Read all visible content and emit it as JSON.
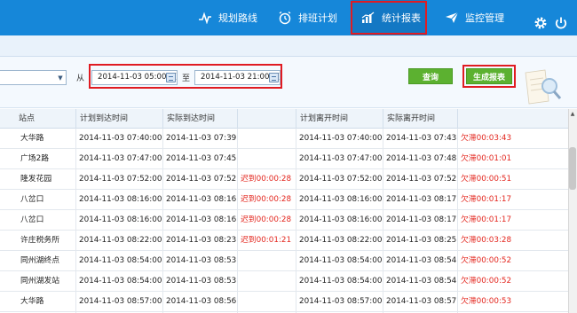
{
  "nav": {
    "items": [
      {
        "label": "规划路线",
        "icon": "route-icon"
      },
      {
        "label": "排班计划",
        "icon": "alarm-clock-icon"
      },
      {
        "label": "统计报表",
        "icon": "bar-chart-icon"
      },
      {
        "label": "监控管理",
        "icon": "send-icon"
      }
    ],
    "active": "统计报表",
    "system_icons": [
      "gear-icon",
      "power-icon"
    ]
  },
  "filter": {
    "combo_value": "",
    "from_label": "从",
    "to_label": "至",
    "start_datetime": "2014-11-03 05:00:0(",
    "end_datetime": "2014-11-03 21:00:0(",
    "query_button": "查询",
    "generate_button": "生成报表"
  },
  "table": {
    "columns": [
      "站点",
      "计划到达时间",
      "实际到达时间",
      "",
      "计划离开时间",
      "实际离开时间",
      ""
    ],
    "rows": [
      {
        "station": "大华路",
        "plan_arrive": "2014-11-03 07:40:00",
        "actual_arrive": "2014-11-03 07:39:53",
        "arrive_status": "",
        "plan_leave": "2014-11-03 07:40:00",
        "actual_leave": "2014-11-03 07:43:43",
        "leave_status": "欠滞00:03:43"
      },
      {
        "station": "广场2路",
        "plan_arrive": "2014-11-03 07:47:00",
        "actual_arrive": "2014-11-03 07:45:30",
        "arrive_status": "",
        "plan_leave": "2014-11-03 07:47:00",
        "actual_leave": "2014-11-03 07:48:01",
        "leave_status": "欠滞00:01:01"
      },
      {
        "station": "隆发花园",
        "plan_arrive": "2014-11-03 07:52:00",
        "actual_arrive": "2014-11-03 07:52:28",
        "arrive_status": "迟到00:00:28",
        "plan_leave": "2014-11-03 07:52:00",
        "actual_leave": "2014-11-03 07:52:51",
        "leave_status": "欠滞00:00:51"
      },
      {
        "station": "八岔口",
        "plan_arrive": "2014-11-03 08:16:00",
        "actual_arrive": "2014-11-03 08:16:28",
        "arrive_status": "迟到00:00:28",
        "plan_leave": "2014-11-03 08:16:00",
        "actual_leave": "2014-11-03 08:17:17",
        "leave_status": "欠滞00:01:17"
      },
      {
        "station": "八岔口",
        "plan_arrive": "2014-11-03 08:16:00",
        "actual_arrive": "2014-11-03 08:16:28",
        "arrive_status": "迟到00:00:28",
        "plan_leave": "2014-11-03 08:16:00",
        "actual_leave": "2014-11-03 08:17:17",
        "leave_status": "欠滞00:01:17"
      },
      {
        "station": "许庄税务所",
        "plan_arrive": "2014-11-03 08:22:00",
        "actual_arrive": "2014-11-03 08:23:21",
        "arrive_status": "迟到00:01:21",
        "plan_leave": "2014-11-03 08:22:00",
        "actual_leave": "2014-11-03 08:25:28",
        "leave_status": "欠滞00:03:28"
      },
      {
        "station": "同州湖终点",
        "plan_arrive": "2014-11-03 08:54:00",
        "actual_arrive": "2014-11-03 08:53:38",
        "arrive_status": "",
        "plan_leave": "2014-11-03 08:54:00",
        "actual_leave": "2014-11-03 08:54:52",
        "leave_status": "欠滞00:00:52"
      },
      {
        "station": "同州湖发站",
        "plan_arrive": "2014-11-03 08:54:00",
        "actual_arrive": "2014-11-03 08:53:38",
        "arrive_status": "",
        "plan_leave": "2014-11-03 08:54:00",
        "actual_leave": "2014-11-03 08:54:52",
        "leave_status": "欠滞00:00:52"
      },
      {
        "station": "大华路",
        "plan_arrive": "2014-11-03 08:57:00",
        "actual_arrive": "2014-11-03 08:56:50",
        "arrive_status": "",
        "plan_leave": "2014-11-03 08:57:00",
        "actual_leave": "2014-11-03 08:57:53",
        "leave_status": "欠滞00:00:53"
      }
    ]
  },
  "colors": {
    "header_bg": "#1687d9",
    "highlight_border": "#e01b22",
    "status_red": "#e3261e",
    "button_green": "#5cb130"
  }
}
